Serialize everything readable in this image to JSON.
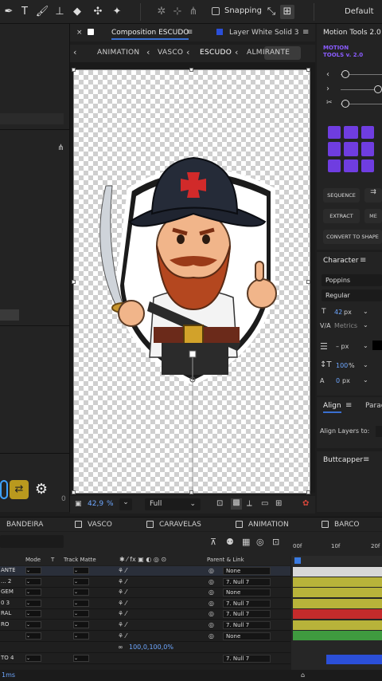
{
  "toolbar": {
    "snapping_label": "Snapping",
    "workspace_label": "Default",
    "icons": [
      "pen-icon",
      "type-icon",
      "brush-icon",
      "clone-stamp-icon",
      "eraser-icon",
      "roto-brush-icon",
      "puppet-pin-icon",
      "axis-world-icon",
      "axis-local-icon",
      "axis-view-icon",
      "snap-toggle-icon",
      "snap-options-icon"
    ]
  },
  "comp_panel": {
    "tab_title": "Composition ESCUDO",
    "layer_tab_title": "Layer White Solid 3",
    "nav": [
      "ANIMATION",
      "VASCO",
      "ESCUDO",
      "ALMIRANTE"
    ],
    "active_nav": "ESCUDO",
    "zoom": "42,9",
    "zoom_unit": "%",
    "resolution": "Full"
  },
  "motion_tools": {
    "title": "Motion Tools 2.0",
    "logo_line1": "MOTION",
    "logo_line2": "TOOLS v. 2.0",
    "buttons": [
      "SEQUENCE",
      "EXTRACT",
      "CONVERT TO SHAPE"
    ]
  },
  "character": {
    "title": "Character",
    "font": "Poppins",
    "style": "Regular",
    "size": "42",
    "size_unit": "px",
    "kerning": "Metrics",
    "leading": "– px",
    "vscale": "100",
    "vscale_unit": "%",
    "baseline": "0",
    "baseline_unit": "px"
  },
  "align": {
    "tab_align": "Align",
    "tab_paragraph": "Parag",
    "align_to_label": "Align Layers to:"
  },
  "buttcapper": {
    "title": "Buttcapper"
  },
  "timeline": {
    "tabs": [
      "BANDEIRA",
      "VASCO",
      "CARAVELAS",
      "ANIMATION",
      "BARCO"
    ],
    "columns": {
      "mode": "Mode",
      "t": "T",
      "track_matte": "Track Matte",
      "parent": "Parent & Link"
    },
    "ruler": [
      "00f",
      "10f",
      "20f"
    ],
    "layers": [
      {
        "name": "ANTE]",
        "parent": "None",
        "color": "#c9c9c9"
      },
      {
        "name": "... 2",
        "parent": "7. Null 7",
        "color": "#b8b33a"
      },
      {
        "name": "GEM",
        "parent": "None",
        "color": "#b8b33a"
      },
      {
        "name": "0 3",
        "parent": "7. Null 7",
        "color": "#b8b33a"
      },
      {
        "name": "RAL",
        "parent": "7. Null 7",
        "color": "#c42b2b"
      },
      {
        "name": "RO",
        "parent": "7. Null 7",
        "color": "#b8b33a"
      },
      {
        "name": "",
        "parent": "None",
        "color": "#3f9a3f"
      }
    ],
    "scale_value": "100,0,100,0%",
    "last_layer_name": "TO 4",
    "last_layer_parent": "7. Null 7",
    "status": "1ms"
  }
}
